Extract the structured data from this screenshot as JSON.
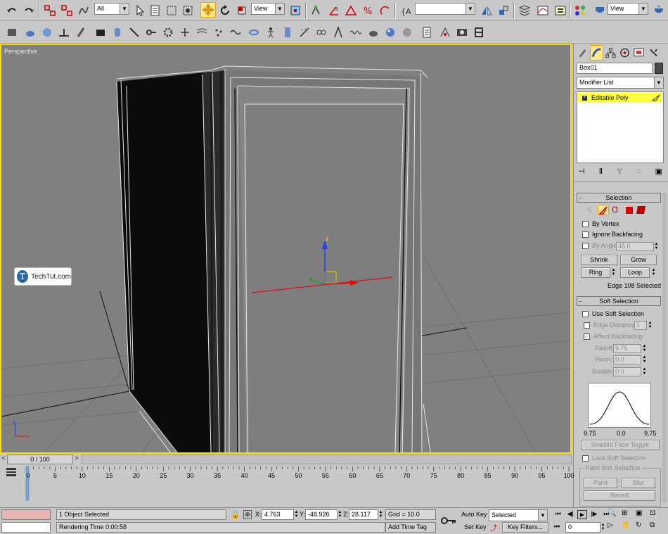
{
  "toolbar": {
    "selection_filter": "All",
    "ref_coord": "View",
    "named_sel": "",
    "view_dd": "View"
  },
  "viewport": {
    "label": "Perspective",
    "watermark": "TechTut.com",
    "gizmo_z": "z",
    "axis_x": "x",
    "axis_y": "y"
  },
  "command_panel": {
    "object_name": "Box01",
    "modifier_list": "Modifier List",
    "stack_item": "Editable Poly",
    "selection": {
      "title": "Selection",
      "by_vertex": "By Vertex",
      "ignore_backfacing": "Ignore Backfacing",
      "by_angle": "By Angle:",
      "angle_value": "45.0",
      "shrink": "Shrink",
      "grow": "Grow",
      "ring": "Ring",
      "loop": "Loop",
      "status": "Edge 108 Selected"
    },
    "soft_selection": {
      "title": "Soft Selection",
      "use_soft": "Use Soft Selection",
      "edge_distance": "Edge Distance:",
      "edge_distance_value": "1",
      "affect_backfacing": "Affect Backfacing",
      "falloff": "Falloff:",
      "falloff_value": "9.75",
      "pinch": "Pinch:",
      "pinch_value": "0.0",
      "bubble": "Bubble:",
      "bubble_value": "0.0",
      "curve_left": "9.75",
      "curve_mid": "0.0",
      "curve_right": "9.75",
      "shaded_face_toggle": "Shaded Face Toggle",
      "lock_soft": "Lock Soft Selection",
      "paint_group": "Paint Soft Selection",
      "paint": "Paint",
      "blur": "Blur",
      "revert": "Revert"
    }
  },
  "timeline": {
    "frame_counter": "0 / 100",
    "ticks": [
      "0",
      "5",
      "10",
      "15",
      "20",
      "25",
      "30",
      "35",
      "40",
      "45",
      "50",
      "55",
      "60",
      "65",
      "70",
      "75",
      "80",
      "85",
      "90",
      "95",
      "100"
    ]
  },
  "status": {
    "objects_selected": "1 Object Selected",
    "rendering_time": "Rendering Time  0:00:58",
    "x_label": "X:",
    "x_value": "4.763",
    "y_label": "Y:",
    "y_value": "-48.926",
    "z_label": "Z:",
    "z_value": "28.117",
    "grid": "Grid = 10.0",
    "add_time_tag": "Add Time Tag",
    "auto_key": "Auto Key",
    "set_key": "Set Key",
    "key_mode": "Selected",
    "key_filters": "Key Filters...",
    "current_frame": "0"
  },
  "colors": {
    "viewport_bg": "#808080",
    "active_border": "#f5e000",
    "stack_highlight": "#ffff40"
  }
}
